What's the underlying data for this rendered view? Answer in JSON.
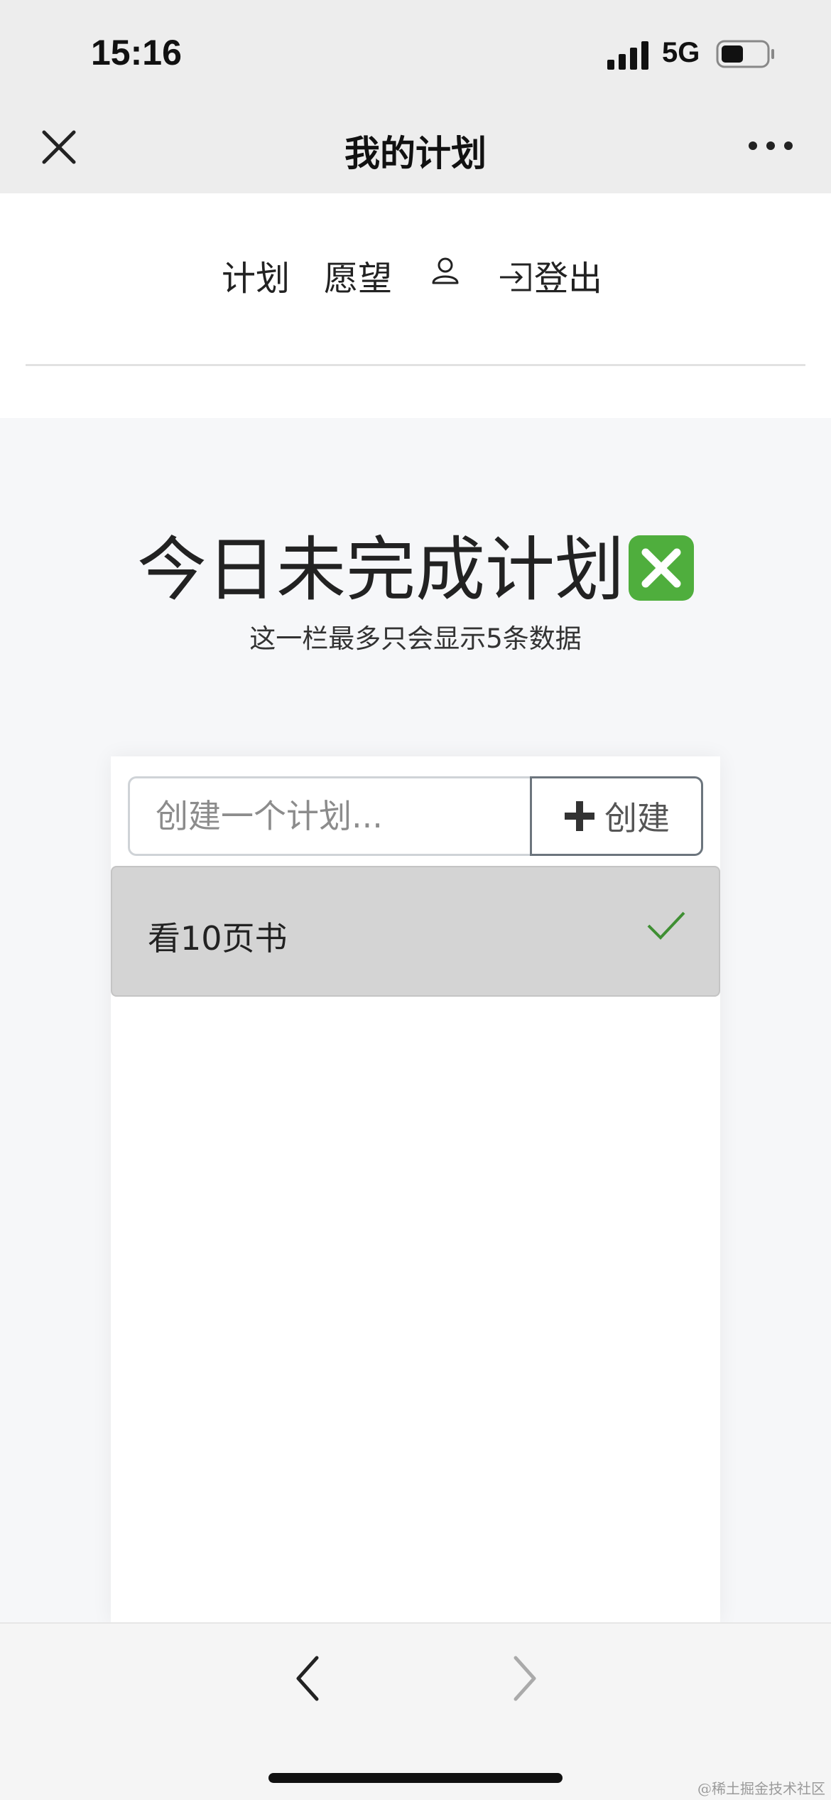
{
  "status_bar": {
    "time": "15:16",
    "network": "5G",
    "battery_level": 0.5
  },
  "nav": {
    "title": "我的计划",
    "close_icon": "close-icon",
    "more_icon": "more-icon"
  },
  "menu": {
    "plan": "计划",
    "wish": "愿望",
    "user_icon": "user-icon",
    "logout_icon": "logout-icon",
    "logout": "登出"
  },
  "hero": {
    "title": "今日未完成计划",
    "title_emoji": "cross-mark-button",
    "subtitle": "这一栏最多只会显示5条数据"
  },
  "form": {
    "placeholder": "创建一个计划...",
    "value": "",
    "create_label": "创建",
    "create_icon": "plus-icon"
  },
  "plans": [
    {
      "text": "看10页书",
      "status_icon": "check-icon"
    }
  ],
  "colors": {
    "accent_green": "#4fae3d",
    "check_green": "#3f8f33",
    "item_bg": "#d4d4d4"
  },
  "watermark": "@稀土掘金技术社区"
}
